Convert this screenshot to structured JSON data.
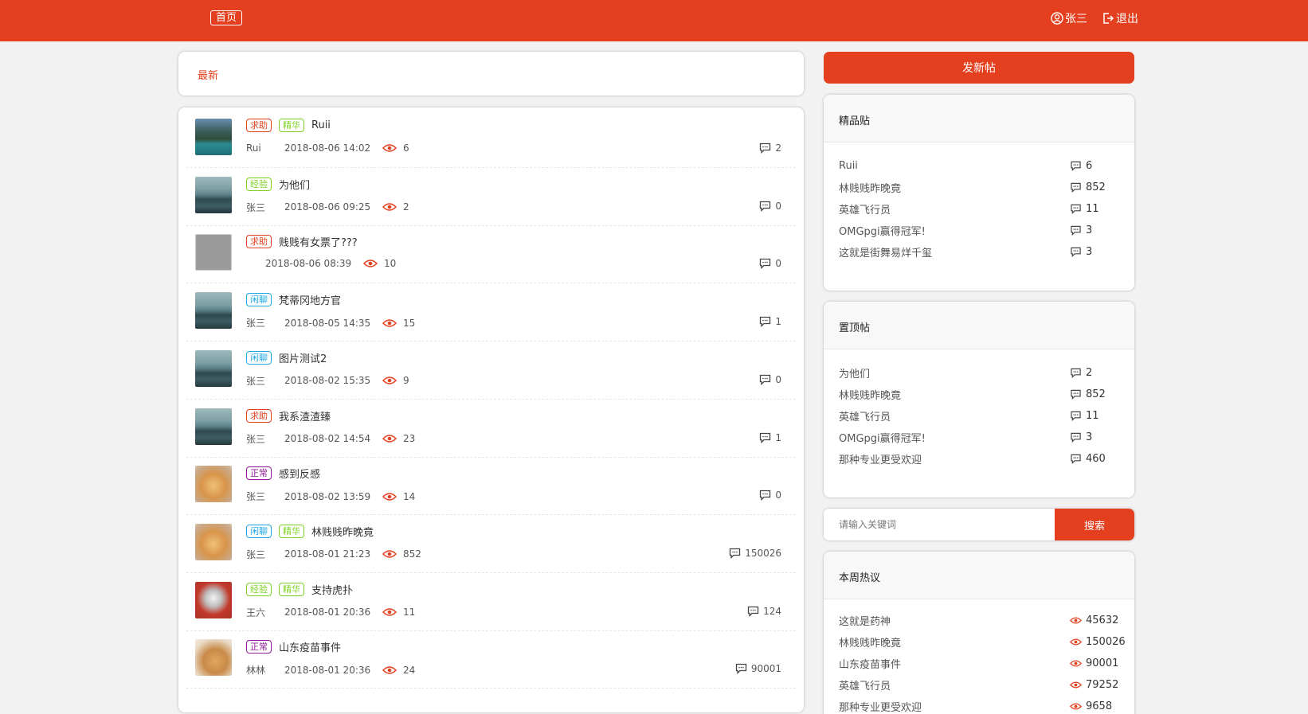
{
  "header": {
    "home": "首页",
    "user": "张三",
    "logout": "退出"
  },
  "tabs": {
    "latest": "最新"
  },
  "posts": [
    {
      "tags": [
        {
          "label": "求助",
          "type": "help"
        },
        {
          "label": "精华",
          "type": "essence"
        }
      ],
      "title": "Ruii",
      "author": "Rui",
      "date": "2018-08-06 14:02",
      "views": "6",
      "comments": "2",
      "avatar": "lake"
    },
    {
      "tags": [
        {
          "label": "经验",
          "type": "exp"
        }
      ],
      "title": "为他们",
      "author": "张三",
      "date": "2018-08-06 09:25",
      "views": "2",
      "comments": "0",
      "avatar": "sea"
    },
    {
      "tags": [
        {
          "label": "求助",
          "type": "help"
        }
      ],
      "title": "贱贱有女票了???",
      "author": "",
      "date": "2018-08-06 08:39",
      "views": "10",
      "comments": "0",
      "avatar": "broken"
    },
    {
      "tags": [
        {
          "label": "闲聊",
          "type": "chat"
        }
      ],
      "title": "梵蒂冈地方官",
      "author": "张三",
      "date": "2018-08-05 14:35",
      "views": "15",
      "comments": "1",
      "avatar": "sea"
    },
    {
      "tags": [
        {
          "label": "闲聊",
          "type": "chat"
        }
      ],
      "title": "图片测试2",
      "author": "张三",
      "date": "2018-08-02 15:35",
      "views": "9",
      "comments": "0",
      "avatar": "sea"
    },
    {
      "tags": [
        {
          "label": "求助",
          "type": "help"
        }
      ],
      "title": "我系渣渣臻",
      "author": "张三",
      "date": "2018-08-02 14:54",
      "views": "23",
      "comments": "1",
      "avatar": "sea"
    },
    {
      "tags": [
        {
          "label": "正常",
          "type": "normal"
        }
      ],
      "title": "感到反感",
      "author": "张三",
      "date": "2018-08-02 13:59",
      "views": "14",
      "comments": "0",
      "avatar": "dog"
    },
    {
      "tags": [
        {
          "label": "闲聊",
          "type": "chat"
        },
        {
          "label": "精华",
          "type": "essence"
        }
      ],
      "title": "林贱贱昨晚竟",
      "author": "张三",
      "date": "2018-08-01 21:23",
      "views": "852",
      "comments": "150026",
      "avatar": "dog"
    },
    {
      "tags": [
        {
          "label": "经验",
          "type": "exp"
        },
        {
          "label": "精华",
          "type": "essence"
        }
      ],
      "title": "支持虎扑",
      "author": "王六",
      "date": "2018-08-01 20:36",
      "views": "11",
      "comments": "124",
      "avatar": "dog2"
    },
    {
      "tags": [
        {
          "label": "正常",
          "type": "normal"
        }
      ],
      "title": "山东疫苗事件",
      "author": "林林",
      "date": "2018-08-01 20:36",
      "views": "24",
      "comments": "90001",
      "avatar": "dog3"
    }
  ],
  "sidebar": {
    "new_post": "发新帖",
    "featured": {
      "title": "精品贴",
      "items": [
        {
          "title": "Ruii",
          "count": "6"
        },
        {
          "title": "林贱贱昨晚竟",
          "count": "852"
        },
        {
          "title": "英雄飞行员",
          "count": "11"
        },
        {
          "title": "OMGpgi赢得冠军!",
          "count": "3"
        },
        {
          "title": "这就是街舞易烊千玺",
          "count": "3"
        }
      ]
    },
    "pinned": {
      "title": "置顶帖",
      "items": [
        {
          "title": "为他们",
          "count": "2"
        },
        {
          "title": "林贱贱昨晚竟",
          "count": "852"
        },
        {
          "title": "英雄飞行员",
          "count": "11"
        },
        {
          "title": "OMGpgi赢得冠军!",
          "count": "3"
        },
        {
          "title": "那种专业更受欢迎",
          "count": "460"
        }
      ]
    },
    "search": {
      "placeholder": "请输入关键词",
      "button": "搜索"
    },
    "hot": {
      "title": "本周热议",
      "items": [
        {
          "title": "这就是药神",
          "count": "45632"
        },
        {
          "title": "林贱贱昨晚竟",
          "count": "150026"
        },
        {
          "title": "山东疫苗事件",
          "count": "90001"
        },
        {
          "title": "英雄飞行员",
          "count": "79252"
        },
        {
          "title": "那种专业更受欢迎",
          "count": "9658"
        }
      ]
    }
  },
  "colors": {
    "brand": "#e4401f",
    "help": "#e4401f",
    "essence": "#7ed321",
    "chat": "#1ea7e4",
    "normal": "#8b1a96"
  }
}
